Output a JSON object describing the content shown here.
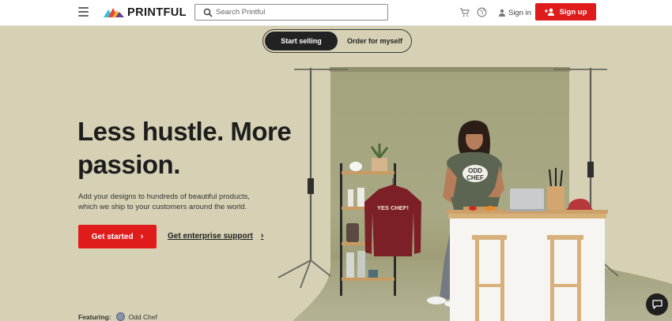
{
  "header": {
    "logo_text": "PRINTFUL",
    "search": {
      "placeholder": "Search Printful"
    },
    "icons": [
      "menu-icon",
      "cart-icon",
      "globe-icon",
      "user-icon",
      "add-user-icon",
      "search-icon"
    ],
    "sign_in_label": "Sign in",
    "sign_up_label": "Sign up"
  },
  "toggle": {
    "options": [
      {
        "label": "Start selling",
        "active": true
      },
      {
        "label": "Order for myself",
        "active": false
      }
    ]
  },
  "hero": {
    "headline": "Less hustle. More passion.",
    "subtext": "Add your designs to hundreds of beautiful products, which we ship to your customers around the world.",
    "cta_primary": "Get started",
    "cta_secondary": "Get enterprise support",
    "featuring_label": "Featuring:",
    "featuring_brand": "Odd Chef"
  },
  "scene": {
    "sweatshirt_text": "YES CHEF!",
    "tshirt_text": [
      "ODD",
      "CHEF"
    ]
  },
  "colors": {
    "brand_red": "#e01b1b",
    "hero_bg": "#d6d1b4",
    "backdrop": "#a7a681"
  }
}
